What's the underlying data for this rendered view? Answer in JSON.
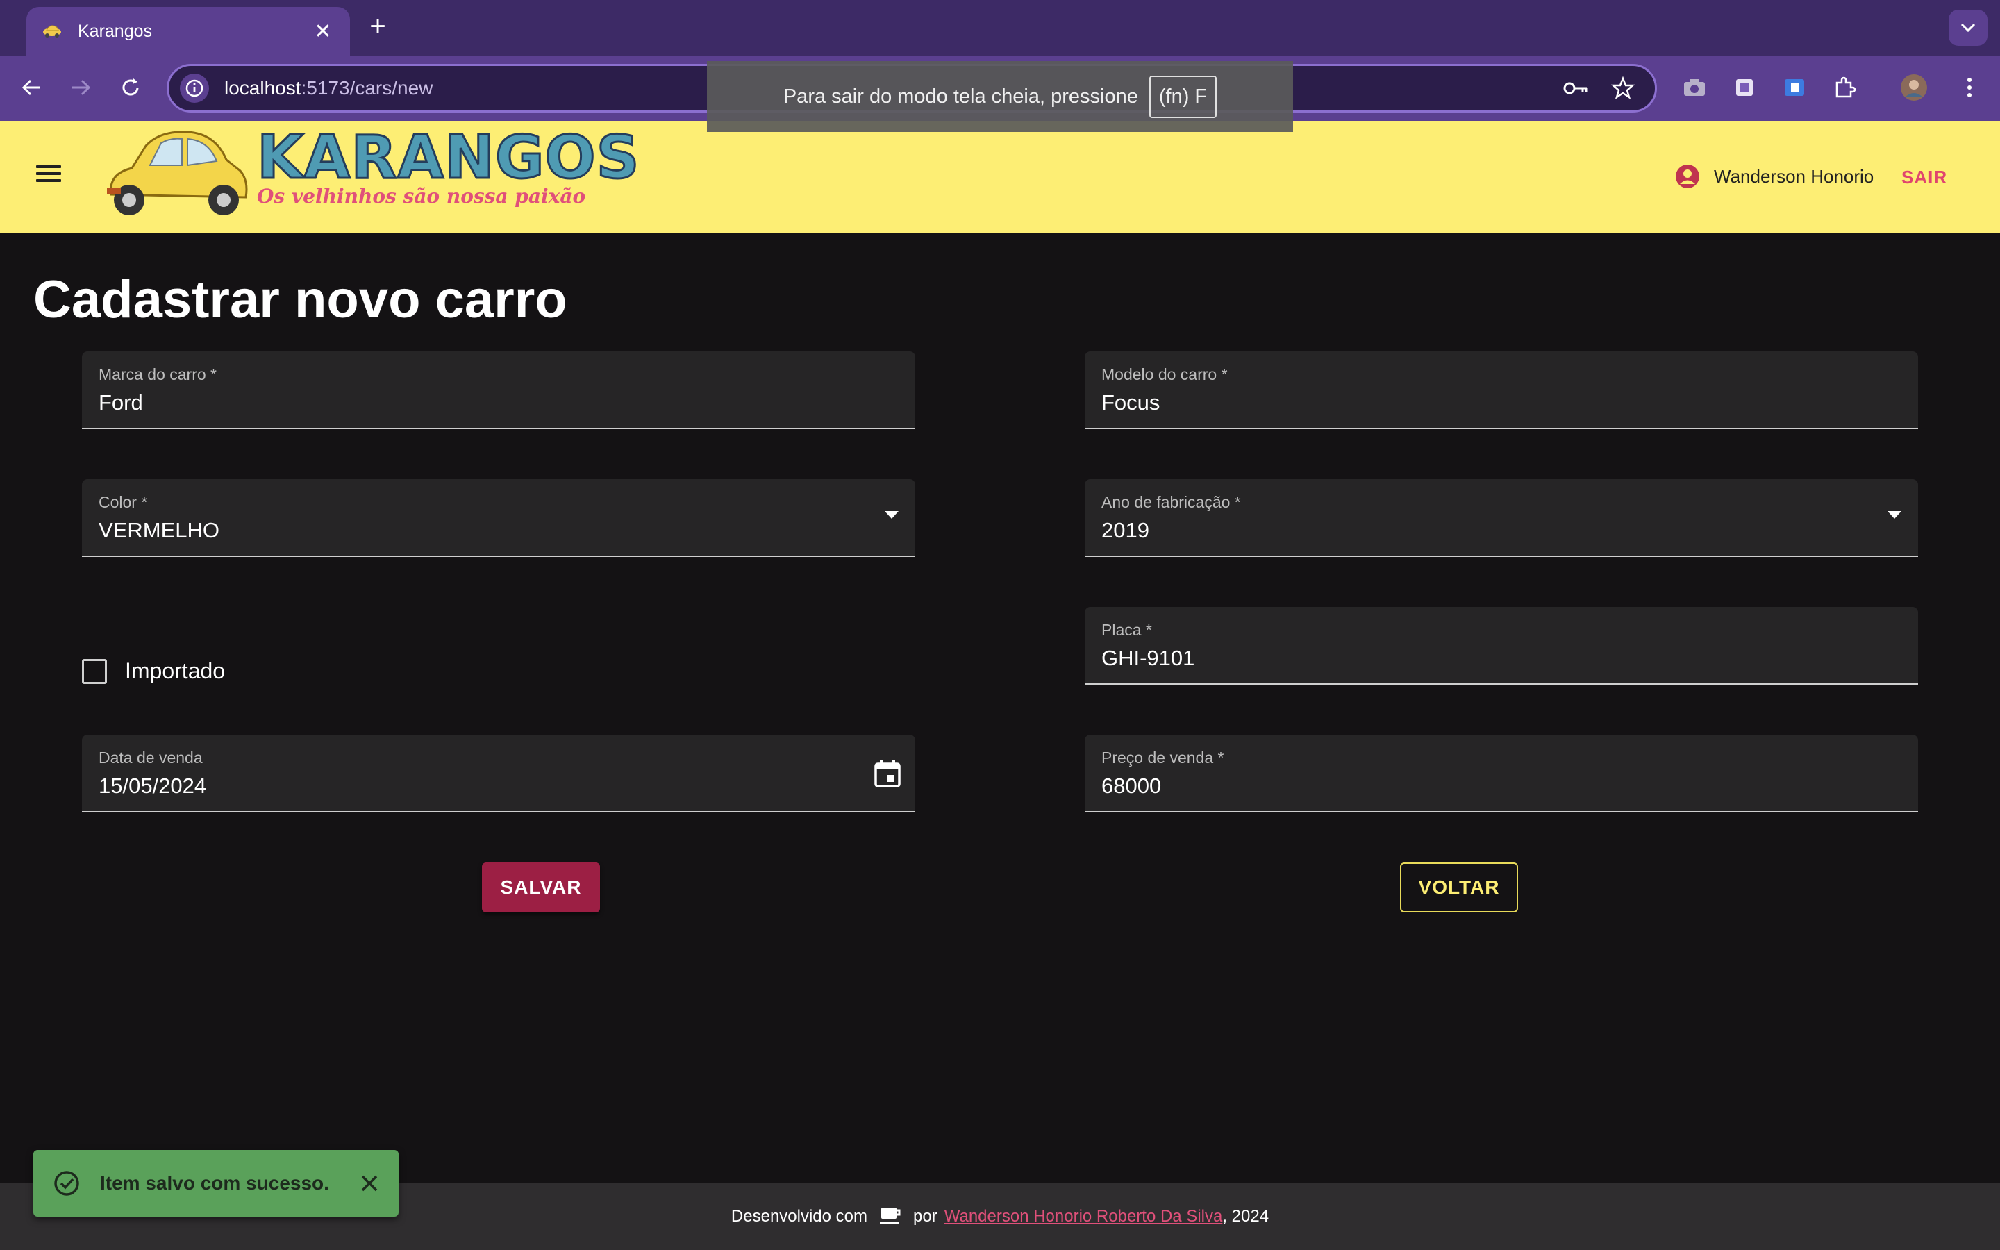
{
  "browser": {
    "tab_title": "Karangos",
    "new_tab_symbol": "+",
    "close_symbol": "✕",
    "url_host": "localhost",
    "url_rest": ":5173/cars/new",
    "fullscreen_notice": "Para sair do modo tela cheia, pressione",
    "fullscreen_key": "(fn) F"
  },
  "header": {
    "logo_title": "KARANGOS",
    "logo_subtitle": "Os velhinhos são nossa paixão",
    "user_name": "Wanderson Honorio",
    "logout_label": "SAIR",
    "background_color": "#fdee74"
  },
  "page": {
    "title": "Cadastrar novo carro"
  },
  "form": {
    "brand": {
      "label": "Marca do carro *",
      "value": "Ford"
    },
    "model": {
      "label": "Modelo do carro *",
      "value": "Focus"
    },
    "color": {
      "label": "Color *",
      "value": "VERMELHO"
    },
    "year": {
      "label": "Ano de fabricação *",
      "value": "2019"
    },
    "imported": {
      "label": "Importado",
      "checked": false
    },
    "plate": {
      "label": "Placa *",
      "value": "GHI-9101"
    },
    "sale_date": {
      "label": "Data de venda",
      "value": "15/05/2024"
    },
    "sale_price": {
      "label": "Preço de venda *",
      "value": "68000"
    },
    "save_label": "SALVAR",
    "back_label": "VOLTAR"
  },
  "footer": {
    "prefix": "Desenvolvido com",
    "by": "por",
    "author": "Wanderson Honorio Roberto Da Silva",
    "suffix": ", 2024"
  },
  "snackbar": {
    "message": "Item salvo com sucesso.",
    "color": "#5aa15a"
  },
  "colors": {
    "accent": "#9c1f44",
    "link": "#e0507a",
    "browser_frame": "#5b3f90",
    "page_bg": "#141214"
  }
}
